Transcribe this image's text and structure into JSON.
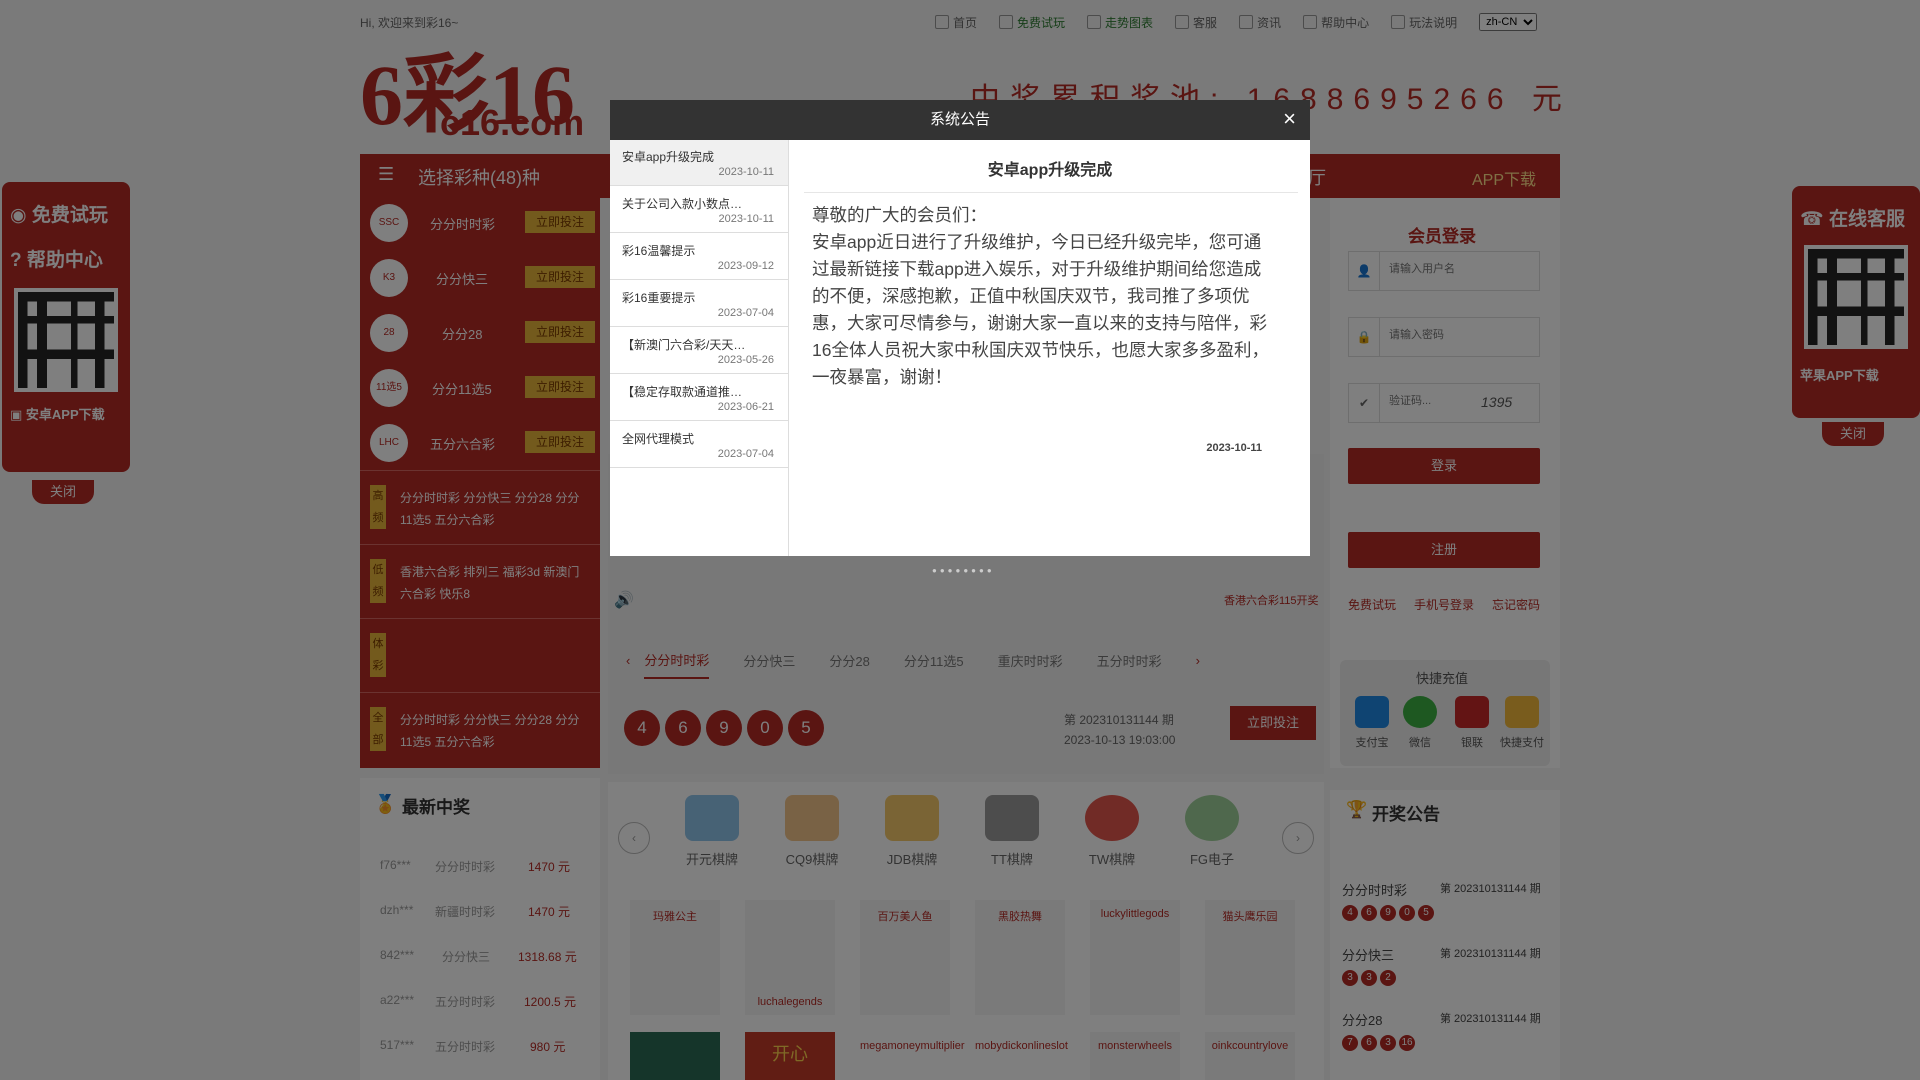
{
  "topbar": {
    "greeting": "Hi, 欢迎来到彩16~",
    "links": [
      "首页",
      "免费试玩",
      "走势图表",
      "客服",
      "资讯",
      "帮助中心",
      "玩法说明"
    ],
    "language": "zh-CN"
  },
  "logo": {
    "big": "6彩16",
    "domain": "c16.com"
  },
  "jackpot": {
    "label": "中奖累积奖池:",
    "digits": "1688695266",
    "unit": "元"
  },
  "nav": {
    "menu_title": "选择彩种(48)种",
    "hall": "厅",
    "app": "APP下载"
  },
  "lottery_list": [
    {
      "name": "分分时时彩",
      "btn": "立即投注",
      "icon": "ssc"
    },
    {
      "name": "分分快三",
      "btn": "立即投注",
      "icon": "k3"
    },
    {
      "name": "分分28",
      "btn": "立即投注",
      "icon": "28"
    },
    {
      "name": "分分11选5",
      "btn": "立即投注",
      "icon": "11x5"
    },
    {
      "name": "五分六合彩",
      "btn": "立即投注",
      "icon": "lhc"
    }
  ],
  "groups": [
    {
      "tag": "高频",
      "items": "分分时时彩  分分快三  分分28  分分11选5  五分六合彩"
    },
    {
      "tag": "低频",
      "items": "香港六合彩  排列三  福彩3d  新澳门六合彩  快乐8"
    },
    {
      "tag": "体彩",
      "items": ""
    },
    {
      "tag": "全部",
      "items": "分分时时彩  分分快三  分分28  分分11选5  五分六合彩"
    }
  ],
  "latest_wins": {
    "title": "最新中奖",
    "rows": [
      {
        "user": "f76***",
        "game": "分分时时彩",
        "amount": "1470 元"
      },
      {
        "user": "dzh***",
        "game": "新疆时时彩",
        "amount": "1470 元"
      },
      {
        "user": "842***",
        "game": "分分快三",
        "amount": "1318.68 元"
      },
      {
        "user": "a22***",
        "game": "五分时时彩",
        "amount": "1200.5 元"
      },
      {
        "user": "517***",
        "game": "五分时时彩",
        "amount": "980 元"
      }
    ]
  },
  "marquee": "香港六合彩115开奖",
  "tabs": [
    "分分时时彩",
    "分分快三",
    "分分28",
    "分分11选5",
    "重庆时时彩",
    "五分时时彩"
  ],
  "draw": {
    "numbers": [
      "4",
      "6",
      "9",
      "0",
      "5"
    ],
    "period": "第 202310131144 期",
    "time": "2023-10-13 19:03:00",
    "bet_btn": "立即投注"
  },
  "games": [
    "开元棋牌",
    "CQ9棋牌",
    "JDB棋牌",
    "TT棋牌",
    "TW棋牌",
    "FG电子"
  ],
  "thumbs_row1": [
    "玛雅公主",
    "luchalegends",
    "百万美人鱼",
    "黑胶热舞",
    "luckylittlegods",
    "猫头鹰乐园"
  ],
  "thumbs_row2": [
    "",
    "",
    "megamoneymultiplier",
    "mobydickonlineslot",
    "monsterwheels",
    "oinkcountrylove"
  ],
  "login": {
    "title": "会员登录",
    "user_ph": "请输入用户名",
    "pass_ph": "请输入密码",
    "code_ph": "验证码...",
    "captcha": "1395",
    "login_btn": "登录",
    "register_btn": "注册",
    "links": [
      "免费试玩",
      "手机号登录",
      "忘记密码"
    ]
  },
  "quick_pay": {
    "title": "快捷充值",
    "items": [
      "支付宝",
      "微信",
      "银联",
      "快捷支付"
    ]
  },
  "draw_notice": {
    "title": "开奖公告",
    "rows": [
      {
        "name": "分分时时彩",
        "period": "第 202310131144 期",
        "balls": [
          "4",
          "6",
          "9",
          "0",
          "5"
        ]
      },
      {
        "name": "分分快三",
        "period": "第 202310131144 期",
        "balls": [
          "3",
          "3",
          "2"
        ]
      },
      {
        "name": "分分28",
        "period": "第 202310131144 期",
        "balls": [
          "7",
          "6",
          "3",
          "16"
        ]
      }
    ]
  },
  "left_float": {
    "trial": "免费试玩",
    "help": "帮助中心",
    "android": "安卓APP下载",
    "close": "关闭"
  },
  "right_float": {
    "service": "在线客服",
    "ios": "苹果APP下载",
    "close": "关闭"
  },
  "modal": {
    "title": "系统公告",
    "close": "×",
    "list": [
      {
        "title": "安卓app升级完成",
        "date": "2023-10-11"
      },
      {
        "title": "关于公司入款小数点…",
        "date": "2023-10-11"
      },
      {
        "title": "彩16温馨提示",
        "date": "2023-09-12"
      },
      {
        "title": "彩16重要提示",
        "date": "2023-07-04"
      },
      {
        "title": "【新澳门六合彩/天天…",
        "date": "2023-05-26"
      },
      {
        "title": "【稳定存取款通道推…",
        "date": "2023-06-21"
      },
      {
        "title": "全网代理模式",
        "date": "2023-07-04"
      }
    ],
    "article_title": "安卓app升级完成",
    "article_body": "尊敬的广大的会员们：\n安卓app近日进行了升级维护，今日已经升级完毕，您可通过最新链接下载app进入娱乐，对于升级维护期间给您造成的不便，深感抱歉，正值中秋国庆双节，我司推了多项优惠，大家可尽情参与，谢谢大家一直以来的支持与陪伴，彩16全体人员祝大家中秋国庆双节快乐，也愿大家多多盈利，一夜暴富，谢谢！",
    "article_date": "2023-10-11"
  },
  "colors": {
    "brand": "#b52a25",
    "gold": "#e6b53a"
  }
}
